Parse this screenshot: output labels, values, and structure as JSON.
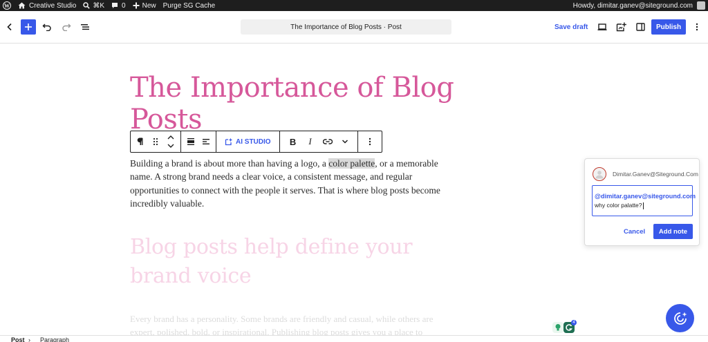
{
  "admin_bar": {
    "site_name": "Creative Studio",
    "search_shortcut": "⌘K",
    "comments_count": "0",
    "new_label": "New",
    "purge_label": "Purge SG Cache",
    "howdy": "Howdy, dimitar.ganev@siteground.com"
  },
  "header": {
    "document_title": "The Importance of Blog Posts · Post",
    "save_draft": "Save draft",
    "publish": "Publish"
  },
  "toolbar": {
    "ai_studio": "AI STUDIO",
    "bold": "B",
    "italic": "I"
  },
  "content": {
    "title": "The Importance of Blog Posts",
    "paragraph_before": "Building a brand is about more than having a logo, a ",
    "paragraph_highlight": "color palette",
    "paragraph_after": ", or a memorable name. A strong brand needs a clear voice, a consistent message, and regular opportunities to connect with the people it serves. That is where blog posts become incredibly valuable.",
    "heading2": "Blog posts help define your brand voice",
    "next_paragraph": "Every brand has a personality. Some brands are friendly and casual, while others are expert, polished, bold, or inspirational. Publishing blog posts gives you a place to"
  },
  "note": {
    "author": "Dimitar.Ganev@Siteground.Com",
    "mention": "@dimitar.ganev@siteground.com",
    "text": "why color palatte?",
    "cancel": "Cancel",
    "add_note": "Add note"
  },
  "extension_badge": "4",
  "breadcrumb": {
    "items": [
      "Post",
      "Paragraph"
    ],
    "separator": "›"
  },
  "colors": {
    "accent": "#3858e9",
    "title_pink": "#d6589a",
    "admin_bar_bg": "#1e1e1e"
  },
  "icons": [
    "wordpress-icon",
    "home-icon",
    "search-icon",
    "comment-icon",
    "plus-icon",
    "back-chevron-icon",
    "undo-icon",
    "redo-icon",
    "list-view-icon",
    "desktop-preview-icon",
    "notes-icon",
    "sidebar-icon",
    "kebab-menu-icon",
    "paragraph-icon",
    "drag-handle-icon",
    "move-up-down-icon",
    "align-icon",
    "text-align-icon",
    "ai-studio-icon",
    "link-icon",
    "chevron-down-icon",
    "avatar-icon",
    "ai-assistant-icon"
  ]
}
